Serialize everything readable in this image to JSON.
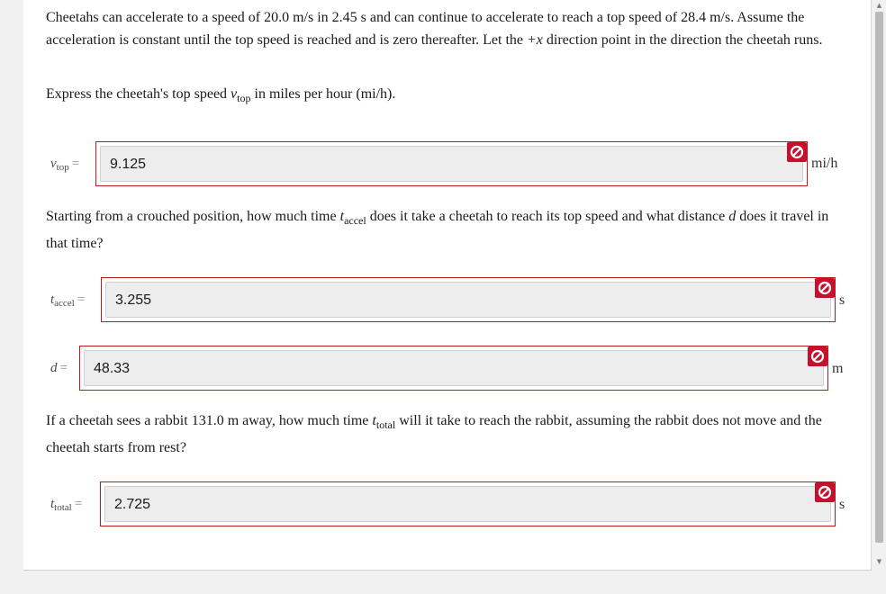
{
  "question1": {
    "text_a": "Cheetahs can accelerate to a speed of ",
    "v1": "20.0 m/s",
    "text_b": " in ",
    "t1": "2.45 s",
    "text_c": " and can continue to accelerate to reach a top speed of ",
    "v2": "28.4 m/s",
    "text_d": ". Assume the acceleration is constant until the top speed is reached and is zero thereafter. Let the ",
    "dir": "+x",
    "text_e": " direction point in the direction the cheetah runs.",
    "prompt_a": "Express the cheetah's top speed ",
    "var": "v",
    "var_sub": "top",
    "prompt_b": " in miles per hour ",
    "prompt_unit": "(mi/h)",
    "prompt_c": "."
  },
  "answers": {
    "vtop": {
      "sym": "v",
      "sub": "top",
      "eq": "=",
      "value": "9.125",
      "unit": "mi/h",
      "status": "incorrect"
    },
    "taccel": {
      "sym": "t",
      "sub": "accel",
      "eq": "=",
      "value": "3.255",
      "unit": "s",
      "status": "incorrect"
    },
    "d": {
      "sym": "d",
      "sub": "",
      "eq": "=",
      "value": "48.33",
      "unit": "m",
      "status": "incorrect"
    },
    "ttotal": {
      "sym": "t",
      "sub": "total",
      "eq": "=",
      "value": "2.725",
      "unit": "s",
      "status": "incorrect"
    }
  },
  "question2": {
    "text_a": "Starting from a crouched position, how much time ",
    "var_t": "t",
    "var_t_sub": "accel",
    "text_b": " does it take a cheetah to reach its top speed and what distance ",
    "var_d": "d",
    "text_c": " does it travel in that time?"
  },
  "question3": {
    "text_a": "If a cheetah sees a rabbit ",
    "dist": "131.0 m",
    "text_b": " away, how much time ",
    "var_t": "t",
    "var_t_sub": "total",
    "text_c": " will it take to reach the rabbit, assuming the rabbit does not move and the cheetah starts from rest?"
  },
  "icons": {
    "status_icon": "no-entry-icon",
    "scroll_up": "up-arrow-icon",
    "scroll_down": "down-arrow-icon"
  },
  "colors": {
    "incorrect": "#c8102e",
    "field_border": "#b91c1c"
  }
}
